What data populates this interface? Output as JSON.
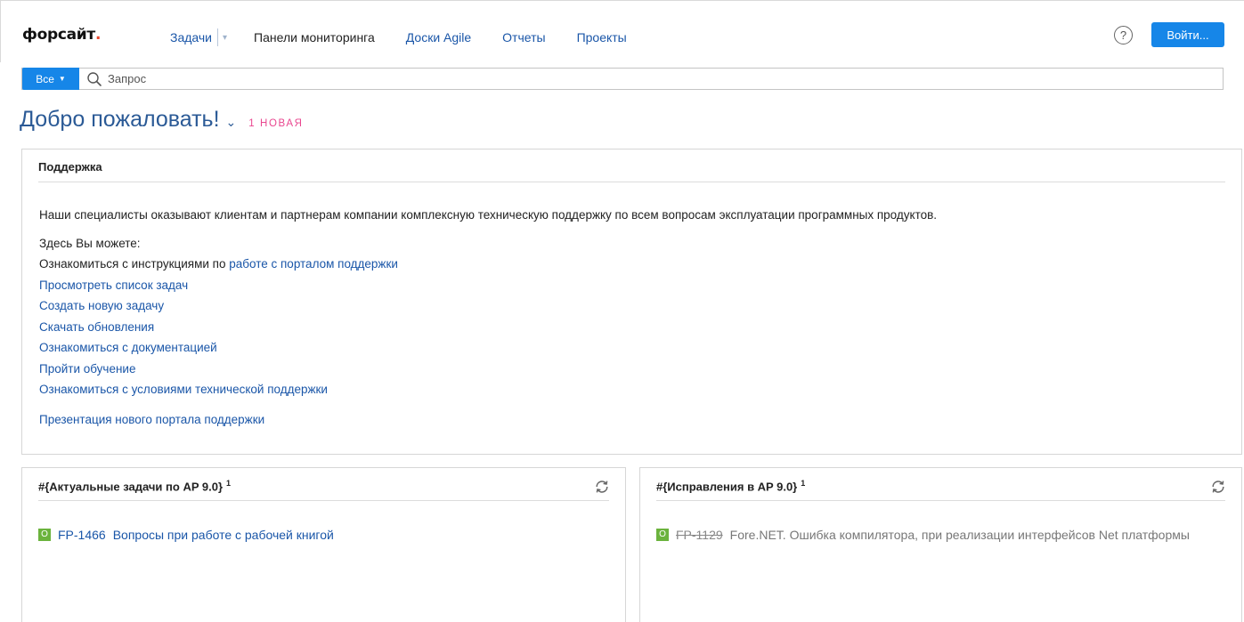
{
  "header": {
    "logo_text": "форсайт",
    "logo_dot": ".",
    "nav": {
      "tasks": "Задачи",
      "panels": "Панели мониторинга",
      "agile": "Доски Agile",
      "reports": "Отчеты",
      "projects": "Проекты"
    },
    "help_symbol": "?",
    "login_label": "Войти..."
  },
  "search": {
    "scope_label": "Все",
    "placeholder": "Запрос"
  },
  "welcome": {
    "title": "Добро пожаловать!",
    "new_badge": "1 НОВАЯ"
  },
  "support": {
    "title": "Поддержка",
    "intro": "Наши специалисты оказывают клиентам и партнерам компании комплексную техническую поддержку по всем вопросам эксплуатации программных продуктов.",
    "here_you_can": "Здесь Вы можете:",
    "instructions_prefix": "Ознакомиться с инструкциями по ",
    "instructions_link": "работе с порталом поддержки",
    "links": [
      "Просмотреть список задач",
      "Создать новую задачу",
      "Скачать обновления",
      "Ознакомиться с документацией",
      "Пройти обучение",
      "Ознакомиться с условиями технической поддержки"
    ],
    "presentation_link": "Презентация нового портала поддержки"
  },
  "gadget_left": {
    "title": "#{Актуальные задачи по AP 9.0}",
    "count": "1",
    "issue": {
      "status": "O",
      "key": "FP-1466",
      "summary": "Вопросы при работе с рабочей книгой"
    }
  },
  "gadget_right": {
    "title": "#{Исправления в AP 9.0}",
    "count": "1",
    "issue": {
      "status": "O",
      "key": "FP-1129",
      "summary": "Fore.NET. Ошибка компилятора, при реализации интерфейсов Net платформы"
    }
  },
  "colors": {
    "accent": "#1686e8",
    "link": "#1a56a8",
    "title": "#2b5a96",
    "badge": "#e9468f",
    "status_green": "#6bb33d",
    "logo_dot": "#e8462c"
  },
  "icons": {
    "help": "question-circle-icon",
    "search": "search-icon",
    "dropdown": "caret-down-icon",
    "refresh": "refresh-icon"
  }
}
